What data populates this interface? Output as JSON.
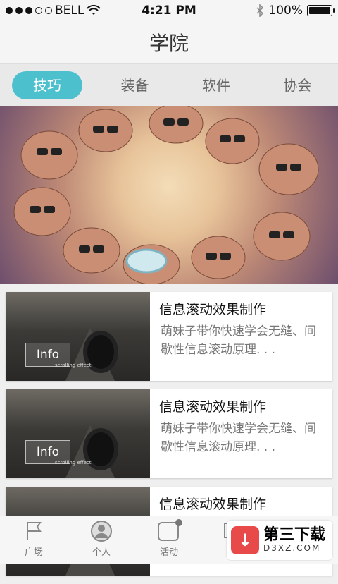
{
  "status_bar": {
    "carrier": "BELL",
    "time": "4:21 PM",
    "battery": "100%"
  },
  "header": {
    "title": "学院"
  },
  "tabs": [
    {
      "label": "技巧",
      "active": true
    },
    {
      "label": "装备",
      "active": false
    },
    {
      "label": "软件",
      "active": false
    },
    {
      "label": "协会",
      "active": false
    }
  ],
  "articles": [
    {
      "title": "信息滚动效果制作",
      "description": "萌妹子带你快速学会无缝、间歇性信息滚动原理. . .",
      "thumb_label": "Info",
      "thumb_sub": "scrolling effect"
    },
    {
      "title": "信息滚动效果制作",
      "description": "萌妹子带你快速学会无缝、间歇性信息滚动原理. . .",
      "thumb_label": "Info",
      "thumb_sub": "scrolling effect"
    },
    {
      "title": "信息滚动效果制作",
      "description": "",
      "thumb_label": "",
      "thumb_sub": ""
    }
  ],
  "tabbar": [
    {
      "label": "广场",
      "icon": "flag-icon"
    },
    {
      "label": "个人",
      "icon": "person-icon"
    },
    {
      "label": "活动",
      "icon": "activity-icon"
    },
    {
      "label": "",
      "icon": "chat-icon"
    }
  ],
  "watermark": {
    "main": "第三下载",
    "sub": "D3XZ.COM"
  },
  "colors": {
    "accent": "#4dc0ce"
  }
}
